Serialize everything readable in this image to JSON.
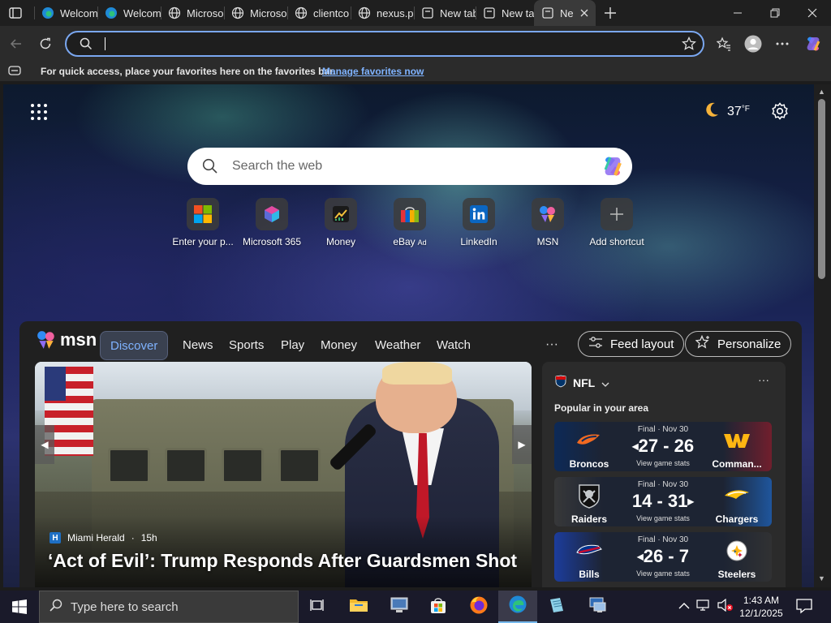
{
  "browser": {
    "tabs": [
      {
        "title": "Welcom",
        "icon": "edge-icon"
      },
      {
        "title": "Welcom",
        "icon": "edge-icon"
      },
      {
        "title": "Microso",
        "icon": "globe-icon"
      },
      {
        "title": "Microso",
        "icon": "globe-icon"
      },
      {
        "title": "clientco",
        "icon": "globe-icon"
      },
      {
        "title": "nexus.p",
        "icon": "globe-icon"
      },
      {
        "title": "New tab",
        "icon": "newtab-icon"
      },
      {
        "title": "New tab",
        "icon": "newtab-icon"
      },
      {
        "title": "Ne",
        "icon": "newtab-icon",
        "active": true
      }
    ],
    "address": {
      "value": "",
      "placeholder": ""
    },
    "favorites_bar": {
      "hint": "For quick access, place your favorites here on the favorites bar.",
      "link": "Manage favorites now"
    },
    "accent": "#7aa7f0"
  },
  "newtab": {
    "weather": {
      "temp": "37",
      "unit": "°F",
      "icon": "moon-icon"
    },
    "search": {
      "placeholder": "Search the web"
    },
    "shortcuts": [
      {
        "label": "Enter your p...",
        "icon": "windows-icon"
      },
      {
        "label": "Microsoft 365",
        "icon": "m365-icon"
      },
      {
        "label": "Money",
        "icon": "money-chart-icon"
      },
      {
        "label": "eBay",
        "ad": "Ad",
        "icon": "shopping-bag-icon"
      },
      {
        "label": "LinkedIn",
        "icon": "linkedin-icon"
      },
      {
        "label": "MSN",
        "icon": "msn-icon"
      },
      {
        "label": "Add shortcut",
        "icon": "plus-icon"
      }
    ]
  },
  "msn": {
    "logo": "msn",
    "nav": [
      "Discover",
      "News",
      "Sports",
      "Play",
      "Money",
      "Weather",
      "Watch"
    ],
    "active_nav": "Discover",
    "more": "···",
    "feed_layout": "Feed layout",
    "personalize": "Personalize",
    "hero": {
      "source": "Miami Herald",
      "source_icon": "H",
      "age": "15h",
      "title": "‘Act of Evil’: Trump Responds After Guardsmen Shot"
    },
    "nfl": {
      "title": "NFL",
      "subtitle": "Popular in your area",
      "games": [
        {
          "status": "Final · Nov 30",
          "team1": "Broncos",
          "team2": "Comman...",
          "score": "27 - 26",
          "link": "View game stats",
          "color1": "#f26a21",
          "color2": "#7a1e2c"
        },
        {
          "status": "Final · Nov 30",
          "team1": "Raiders",
          "team2": "Chargers",
          "score": "14 - 31",
          "link": "View game stats",
          "color1": "#222222",
          "color2": "#1f5ba8"
        },
        {
          "status": "Final · Nov 30",
          "team1": "Bills",
          "team2": "Steelers",
          "score": "26 - 7",
          "link": "View game stats",
          "color1": "#1c3fa8",
          "color2": "#222222"
        }
      ]
    }
  },
  "taskbar": {
    "search_placeholder": "Type here to search",
    "time": "1:43 AM",
    "date": "12/1/2025"
  }
}
